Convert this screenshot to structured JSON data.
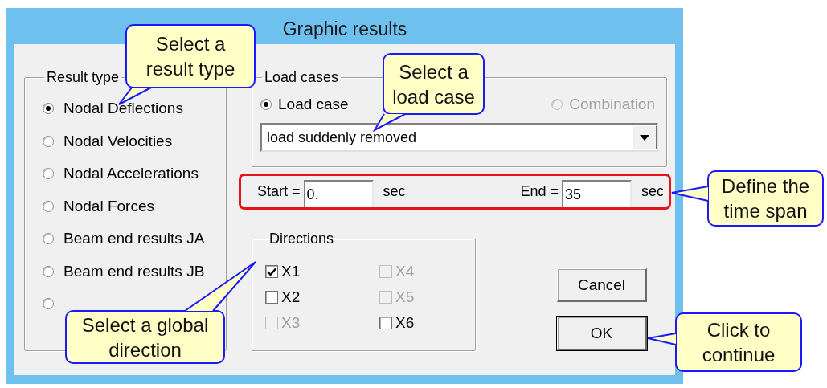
{
  "window": {
    "title": "Graphic results"
  },
  "result_type": {
    "label": "Result type",
    "options": [
      {
        "label": "Nodal Deflections",
        "selected": true
      },
      {
        "label": "Nodal Velocities",
        "selected": false
      },
      {
        "label": "Nodal Accelerations",
        "selected": false
      },
      {
        "label": "Nodal Forces",
        "selected": false
      },
      {
        "label": "Beam end results JA",
        "selected": false
      },
      {
        "label": "Beam end results JB",
        "selected": false
      },
      {
        "selected": false
      }
    ]
  },
  "load_cases": {
    "label": "Load cases",
    "options": [
      {
        "label": "Load case",
        "selected": true,
        "disabled": false
      },
      {
        "label": "Combination",
        "selected": false,
        "disabled": true
      }
    ],
    "dropdown": {
      "value": "load suddenly removed"
    }
  },
  "time_span": {
    "start_label": "Start =",
    "start_value": "0.",
    "start_unit": "sec",
    "end_label": "End =",
    "end_value": "35",
    "end_unit": "sec"
  },
  "directions": {
    "label": "Directions",
    "checkboxes": [
      {
        "label": "X1",
        "checked": true,
        "disabled": false
      },
      {
        "label": "X2",
        "checked": false,
        "disabled": false
      },
      {
        "label": "X3",
        "checked": false,
        "disabled": true
      },
      {
        "label": "X4",
        "checked": false,
        "disabled": true
      },
      {
        "label": "X5",
        "checked": false,
        "disabled": true
      },
      {
        "label": "X6",
        "checked": false,
        "disabled": false
      }
    ]
  },
  "buttons": [
    {
      "label": "Cancel",
      "default": false
    },
    {
      "label": "OK",
      "default": true
    }
  ],
  "callouts": [
    {
      "text": "Select a\nresult type"
    },
    {
      "text": "Select a\nload case"
    },
    {
      "text": "Define the\ntime span"
    },
    {
      "text": "Select a global\ndirection"
    },
    {
      "text": "Click to\ncontinue"
    }
  ]
}
